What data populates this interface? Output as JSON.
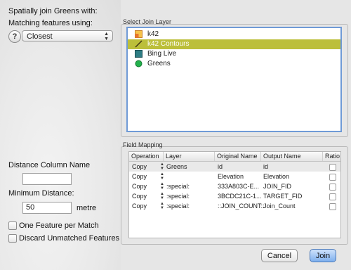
{
  "dialog": {
    "heading": "Spatially join Greens with:",
    "matching_label": "Matching features using:",
    "help_symbol": "?",
    "matching_value": "Closest",
    "select_layer_title": "Select Join Layer",
    "layers": [
      {
        "label": "k42",
        "icon": "polygon-layer-icon",
        "color": "#f2a533"
      },
      {
        "label": "k42 Contours",
        "icon": "line-layer-icon",
        "color": "#5b4a1b",
        "selected": true
      },
      {
        "label": "Bing Live",
        "icon": "raster-layer-icon",
        "color": "#2e7d84"
      },
      {
        "label": "Greens",
        "icon": "point-layer-icon",
        "color": "#22b14c"
      }
    ],
    "field_mapping_title": "Field Mapping",
    "table": {
      "headers": [
        "Operation",
        "Layer",
        "Original Name",
        "Output Name",
        "Ratio"
      ],
      "rows": [
        {
          "operation": "Copy",
          "layer": "Greens",
          "original": "id",
          "output": "id"
        },
        {
          "operation": "Copy",
          "layer": "",
          "original": "Elevation",
          "output": "Elevation"
        },
        {
          "operation": "Copy",
          "layer": ":special:",
          "original": "333A803C-E...",
          "output": "JOIN_FID"
        },
        {
          "operation": "Copy",
          "layer": ":special:",
          "original": "3BCDC21C-1...",
          "output": "TARGET_FID"
        },
        {
          "operation": "Copy",
          "layer": ":special:",
          "original": "::JOIN_COUNT::",
          "output": "Join_Count"
        }
      ]
    },
    "distance_column_label": "Distance Column Name",
    "distance_column_value": "",
    "min_distance_label": "Minimum Distance:",
    "min_distance_value": "50",
    "min_distance_unit": "metre",
    "one_feature_label": "One Feature per Match",
    "discard_label": "Discard Unmatched Features",
    "cancel_label": "Cancel",
    "join_label": "Join"
  },
  "colors": {
    "selection": "#bcbf3a",
    "list_focus": "#6f9ad6",
    "join_button": "#7fb0ee"
  }
}
